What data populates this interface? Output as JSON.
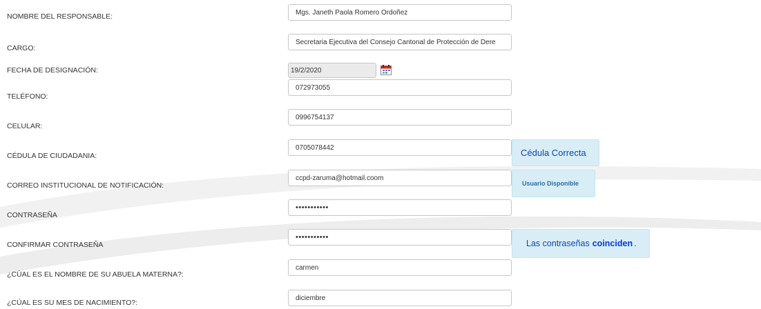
{
  "form": {
    "fields": [
      {
        "key": "responsable",
        "label": "NOMBRE DEL RESPONSABLE:",
        "value": "Mgs. Janeth Paola Romero Ordoñez",
        "type": "text"
      },
      {
        "key": "cargo",
        "label": "CARGO:",
        "value": "Secretaria Ejecutiva del Consejo Cantonal de Protección de Dere",
        "type": "text"
      },
      {
        "key": "fecha",
        "label": "FECHA DE DESIGNACIÓN:",
        "value": "19/2/2020",
        "type": "date",
        "icon": "calendar-icon"
      },
      {
        "key": "telefono",
        "label": "TELÉFONO:",
        "value": "072973055",
        "type": "text"
      },
      {
        "key": "celular",
        "label": "CELULAR:",
        "value": "0996754137",
        "type": "text"
      },
      {
        "key": "cedula",
        "label": "CÉDULA DE CIUDADANIA:",
        "value": "0705078442",
        "type": "text"
      },
      {
        "key": "correo",
        "label": "CORREO INSTITUCIONAL DE NOTIFICACIÓN:",
        "value": "ccpd-zaruma@hotmail.coom",
        "type": "text"
      },
      {
        "key": "contrasena",
        "label": "CONTRASEÑA",
        "value": "•••••••••••",
        "type": "password"
      },
      {
        "key": "confirmar",
        "label": "CONFIRMAR CONTRASEÑA",
        "value": "•••••••••••",
        "type": "password"
      },
      {
        "key": "abuela",
        "label": "¿CÚAL ES EL NOMBRE DE SU ABUELA MATERNA?:",
        "value": "carmen",
        "type": "text"
      },
      {
        "key": "mes",
        "label": "¿CÚAL ES SU MES DE NACIMIENTO?:",
        "value": "diciembre",
        "type": "text"
      }
    ]
  },
  "messages": {
    "cedula": "Cédula Correcta",
    "usuario": "Usuario Disponible",
    "password_pre": "Las contraseñas",
    "password_bold": "coinciden",
    "password_post": "."
  },
  "colors": {
    "message_bg": "#d9edf7",
    "message_border": "#bce8f1",
    "message_text": "#0b49b5",
    "input_border": "#c6c6c6",
    "disabled_input_bg": "#ebebeb"
  }
}
